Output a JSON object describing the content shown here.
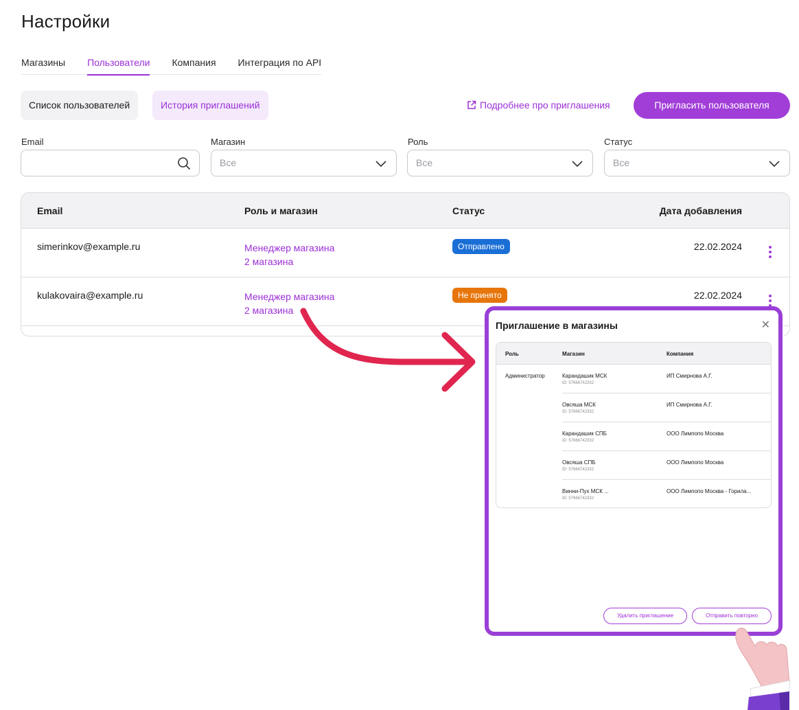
{
  "page": {
    "title": "Настройки"
  },
  "tabs": [
    {
      "label": "Магазины"
    },
    {
      "label": "Пользователи",
      "active": true
    },
    {
      "label": "Компания"
    },
    {
      "label": "Интеграция по API"
    }
  ],
  "segments": {
    "users": "Список пользователей",
    "history": "История приглашений"
  },
  "more_link": "Подробнее про приглашения",
  "invite_button": "Пригласить пользователя",
  "filters": {
    "email": {
      "label": "Email",
      "value": ""
    },
    "store": {
      "label": "Магазин",
      "value": "Все"
    },
    "role": {
      "label": "Роль",
      "value": "Все"
    },
    "status": {
      "label": "Статус",
      "value": "Все"
    }
  },
  "table": {
    "headers": {
      "email": "Email",
      "role_store": "Роль и магазин",
      "status": "Статус",
      "date": "Дата добавления"
    },
    "rows": [
      {
        "email": "simerinkov@example.ru",
        "role": "Менеджер магазина",
        "stores": "2 магазина",
        "status": "Отправлено",
        "status_color": "#1a6fd6",
        "date": "22.02.2024"
      },
      {
        "email": "kulakovaira@example.ru",
        "role": "Менеджер магазина",
        "stores": "2 магазина",
        "status": "Не принято",
        "status_color": "#e6760c",
        "date": "22.02.2024"
      }
    ]
  },
  "modal": {
    "title": "Приглашение в магазины",
    "headers": {
      "role": "Роль",
      "store": "Магазин",
      "company": "Компания"
    },
    "role": "Администратор",
    "rows": [
      {
        "store": "Карандашик МСК",
        "id": "ID: 57666742332",
        "company": "ИП Смирнова А.Г."
      },
      {
        "store": "Овсяша МСК",
        "id": "ID: 57666742332",
        "company": "ИП Смирнова А.Г."
      },
      {
        "store": "Карандашик СПБ",
        "id": "ID: 57666742332",
        "company": "ООО Лимпопо Москва"
      },
      {
        "store": "Овсяша СПБ",
        "id": "ID: 57666742332",
        "company": "ООО Лимпопо Москва"
      },
      {
        "store": "Винни-Пух МСК ...",
        "id": "ID: 57666742332",
        "company": "ООО Лимпопо Москва - Горила..."
      }
    ],
    "delete_button": "Удалить приглашение",
    "resend_button": "Отправить повторно"
  },
  "colors": {
    "accent": "#a23ed8",
    "arrow": "#e0264f",
    "modal_border": "#9a3fd7"
  }
}
